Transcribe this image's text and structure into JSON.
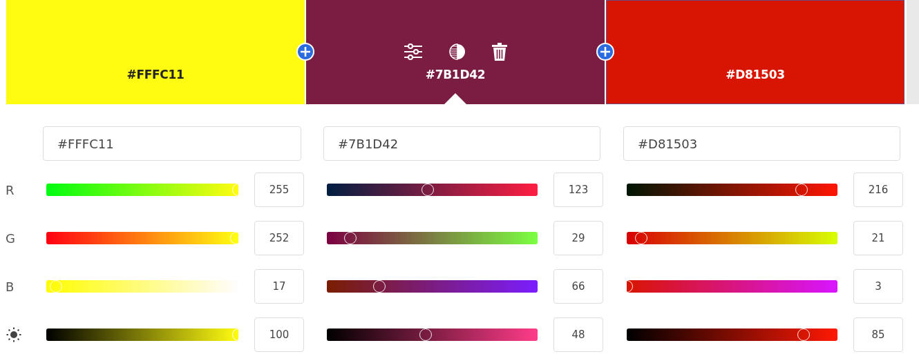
{
  "swatches": [
    {
      "hex": "#FFFC11",
      "color": "#fffc11",
      "selected": false
    },
    {
      "hex": "#7B1D42",
      "color": "#7b1d42",
      "selected": true
    },
    {
      "hex": "#D81503",
      "color": "#d81503",
      "selected": false
    }
  ],
  "channel_labels": [
    {
      "kind": "text",
      "label": "R"
    },
    {
      "kind": "text",
      "label": "G"
    },
    {
      "kind": "text",
      "label": "B"
    },
    {
      "kind": "brightness"
    }
  ],
  "editors": [
    {
      "field": "#FFFC11",
      "channels": [
        {
          "value": "255",
          "level": 1
        },
        {
          "value": "252",
          "level": 0.99
        },
        {
          "value": "17",
          "level": 0.05
        },
        {
          "value": "100",
          "level": 1
        }
      ]
    },
    {
      "field": "#7B1D42",
      "channels": [
        {
          "value": "123",
          "level": 0.48
        },
        {
          "value": "29",
          "level": 0.11
        },
        {
          "value": "66",
          "level": 0.25
        },
        {
          "value": "48",
          "level": 0.47
        }
      ]
    },
    {
      "field": "#D81503",
      "channels": [
        {
          "value": "216",
          "level": 0.83
        },
        {
          "value": "21",
          "level": 0.07
        },
        {
          "value": "3",
          "level": 0.0
        },
        {
          "value": "85",
          "level": 0.84
        }
      ]
    }
  ]
}
